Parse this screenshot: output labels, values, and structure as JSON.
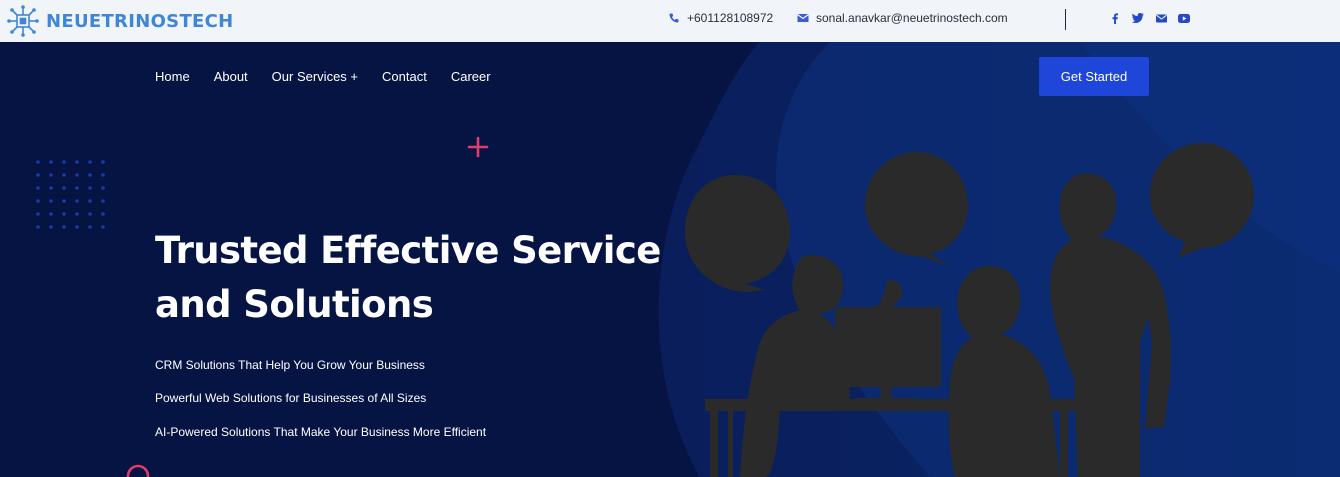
{
  "header": {
    "brand": "NEUETRINOSTECH",
    "phone": "+601128108972",
    "email": "sonal.anavkar@neuetrinostech.com",
    "social_icons": [
      "facebook-icon",
      "twitter-icon",
      "mail-icon",
      "youtube-icon"
    ]
  },
  "nav": {
    "items": [
      "Home",
      "About",
      "Our Services +",
      "Contact",
      "Career"
    ],
    "cta_label": "Get Started"
  },
  "hero": {
    "headline_line1": "Trusted Effective Service",
    "headline_line2": "and Solutions",
    "features": [
      "CRM Solutions That Help You Grow Your Business",
      "Powerful Web Solutions for Businesses of All Sizes",
      "AI-Powered Solutions That Make Your Business More Efficient"
    ]
  },
  "colors": {
    "brand": "#3f87d6",
    "hero_bg": "#061443",
    "accent_button": "#1e46d8",
    "decor_pink": "#e23c6c",
    "silhouette": "#2a2a2a"
  }
}
